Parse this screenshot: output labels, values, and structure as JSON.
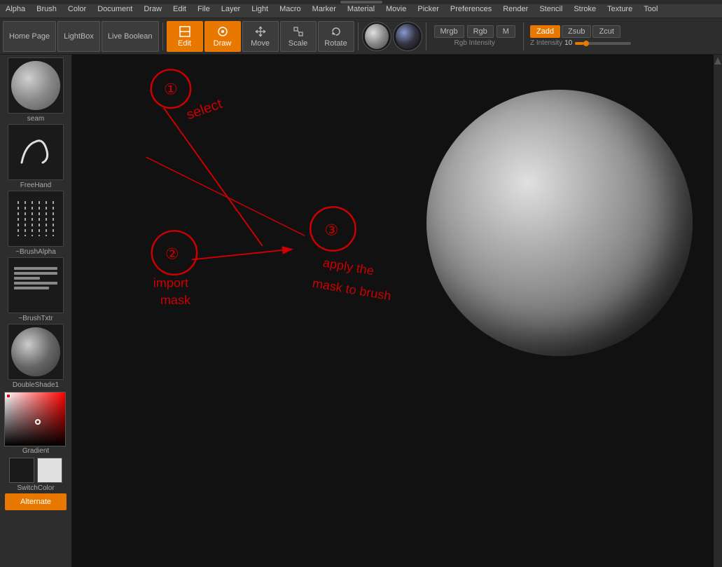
{
  "menu": {
    "items": [
      "Alpha",
      "Brush",
      "Color",
      "Document",
      "Draw",
      "Edit",
      "File",
      "Layer",
      "Light",
      "Macro",
      "Marker",
      "Material",
      "Movie",
      "Picker",
      "Preferences",
      "Render",
      "Stencil",
      "Stroke",
      "Texture",
      "Tool"
    ]
  },
  "toolbar": {
    "home_page": "Home Page",
    "lightbox": "LightBox",
    "live_boolean": "Live Boolean",
    "edit": "Edit",
    "draw": "Draw",
    "move": "Move",
    "scale": "Scale",
    "rotate": "Rotate",
    "mrgb": "Mrgb",
    "rgb": "Rgb",
    "m_label": "M",
    "rgb_intensity": "Rgb Intensity",
    "zadd": "Zadd",
    "zsub": "Zsub",
    "zcut": "Zcut",
    "z_intensity_label": "Z Intensity",
    "z_intensity_value": "10"
  },
  "sidebar": {
    "seam_label": "seam",
    "freehand_label": "FreeHand",
    "brush_alpha_label": "~BrushAlpha",
    "brush_txtr_label": "~BrushTxtr",
    "double_shade_label": "DoubleShade1",
    "gradient_label": "Gradient",
    "switch_color_label": "SwitchColor",
    "alternate_label": "Alternate"
  },
  "canvas": {
    "annotation": {
      "step1_circle": "①",
      "step1_text": "select",
      "step2_circle": "②",
      "step2_text": "import mask",
      "step3_circle": "③",
      "step3_text": "apply the mask to brush"
    }
  }
}
